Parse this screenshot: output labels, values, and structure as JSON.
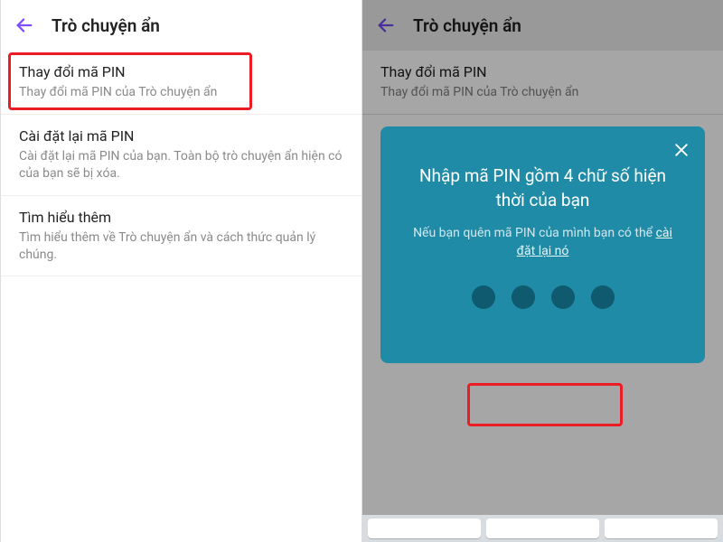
{
  "left": {
    "header": {
      "title": "Trò chuyện ẩn"
    },
    "items": [
      {
        "title": "Thay đổi mã PIN",
        "sub": "Thay đổi mã PIN của Trò chuyện ẩn"
      },
      {
        "title": "Cài đặt lại mã PIN",
        "sub": "Cài đặt lại mã PIN của bạn. Toàn bộ trò chuyện ẩn hiện có của bạn sẽ bị xóa."
      },
      {
        "title": "Tìm hiểu thêm",
        "sub": "Tìm hiểu thêm về Trò chuyện ẩn và cách thức quản lý chúng."
      }
    ]
  },
  "right": {
    "header": {
      "title": "Trò chuyện ẩn"
    },
    "items": [
      {
        "title": "Thay đổi mã PIN",
        "sub": "Thay đổi mã PIN của Trò chuyện ẩn"
      }
    ],
    "dialog": {
      "title": "Nhập mã PIN gồm 4 chữ số hiện thời của bạn",
      "sub_prefix": "Nếu bạn quên mã PIN của mình bạn có thể ",
      "sub_link": "cài đặt lại nó",
      "pin_length": 4
    }
  },
  "colors": {
    "accent": "#7c4dff",
    "dialog_bg": "#1f8ba6",
    "highlight": "#ec1c24"
  }
}
